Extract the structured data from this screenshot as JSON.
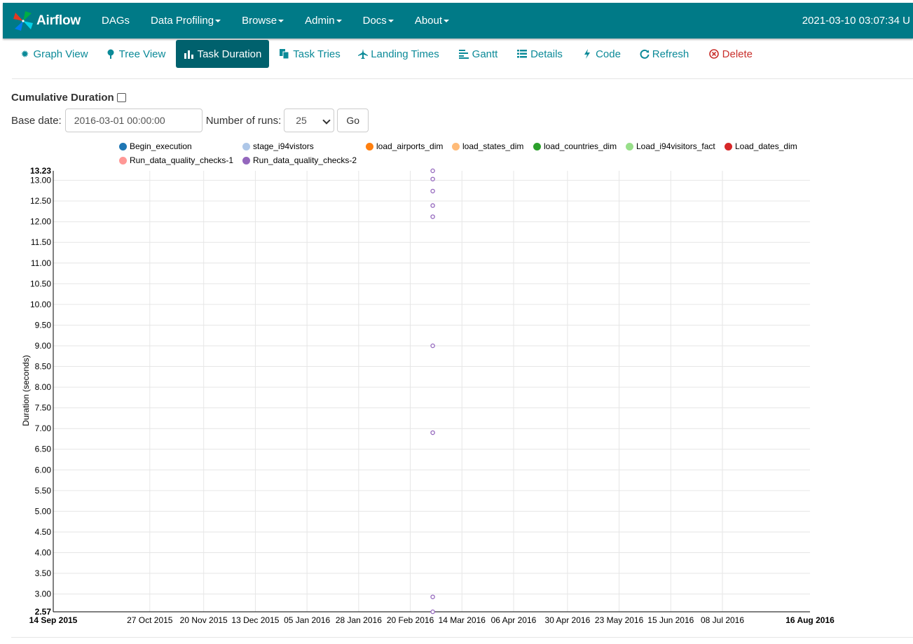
{
  "navbar": {
    "brand": "Airflow",
    "items": [
      {
        "label": "DAGs",
        "dropdown": false
      },
      {
        "label": "Data Profiling",
        "dropdown": true
      },
      {
        "label": "Browse",
        "dropdown": true
      },
      {
        "label": "Admin",
        "dropdown": true
      },
      {
        "label": "Docs",
        "dropdown": true
      },
      {
        "label": "About",
        "dropdown": true
      }
    ],
    "time": "2021-03-10 03:07:34 U",
    "bg_color": "#007a87"
  },
  "tabs": [
    {
      "label": "Graph View",
      "icon": "asterisk-icon",
      "active": false
    },
    {
      "label": "Tree View",
      "icon": "tree-icon",
      "active": false
    },
    {
      "label": "Task Duration",
      "icon": "bar-chart-icon",
      "active": true
    },
    {
      "label": "Task Tries",
      "icon": "duplicate-icon",
      "active": false
    },
    {
      "label": "Landing Times",
      "icon": "plane-icon",
      "active": false
    },
    {
      "label": "Gantt",
      "icon": "align-left-icon",
      "active": false
    },
    {
      "label": "Details",
      "icon": "list-icon",
      "active": false
    },
    {
      "label": "Code",
      "icon": "flash-icon",
      "active": false
    },
    {
      "label": "Refresh",
      "icon": "refresh-icon",
      "active": false
    },
    {
      "label": "Delete",
      "icon": "remove-circle-icon",
      "active": false
    }
  ],
  "form": {
    "cumulative_label": "Cumulative Duration",
    "cumulative_checked": false,
    "base_date_label": "Base date:",
    "base_date_value": "2016-03-01 00:00:00",
    "runs_label": "Number of runs:",
    "runs_value": "25",
    "go_label": "Go"
  },
  "legend": [
    {
      "name": "Begin_execution",
      "color": "#1f77b4"
    },
    {
      "name": "stage_i94vistors",
      "color": "#aec7e8"
    },
    {
      "name": "load_airports_dim",
      "color": "#ff7f0e"
    },
    {
      "name": "load_states_dim",
      "color": "#ffbb78"
    },
    {
      "name": "load_countries_dim",
      "color": "#2ca02c"
    },
    {
      "name": "Load_i94visitors_fact",
      "color": "#98df8a"
    },
    {
      "name": "Load_dates_dim",
      "color": "#d62728"
    },
    {
      "name": "Run_data_quality_checks-1",
      "color": "#ff9896"
    },
    {
      "name": "Run_data_quality_checks-2",
      "color": "#9467bd"
    }
  ],
  "chart_data": {
    "type": "scatter",
    "ylabel": "Duration (seconds)",
    "ylim": [
      2.57,
      13.23
    ],
    "y_ticks": [
      "2.57",
      "3.00",
      "3.50",
      "4.00",
      "4.50",
      "5.00",
      "5.50",
      "6.00",
      "6.50",
      "7.00",
      "7.50",
      "8.00",
      "8.50",
      "9.00",
      "9.50",
      "10.00",
      "10.50",
      "11.00",
      "11.50",
      "12.00",
      "12.50",
      "13.00",
      "13.23"
    ],
    "x_ticks": [
      "14 Sep 2015",
      "27 Oct 2015",
      "20 Nov 2015",
      "13 Dec 2015",
      "05 Jan 2016",
      "28 Jan 2016",
      "20 Feb 2016",
      "14 Mar 2016",
      "06 Apr 2016",
      "30 Apr 2016",
      "23 May 2016",
      "15 Jun 2016",
      "08 Jul 2016",
      "16 Aug 2016"
    ],
    "xlim": [
      "14 Sep 2015",
      "16 Aug 2016"
    ],
    "grid": true,
    "points": [
      {
        "date": "01 Mar 2016",
        "y": 13.23
      },
      {
        "date": "01 Mar 2016",
        "y": 13.03
      },
      {
        "date": "01 Mar 2016",
        "y": 12.74
      },
      {
        "date": "01 Mar 2016",
        "y": 12.39
      },
      {
        "date": "01 Mar 2016",
        "y": 12.12
      },
      {
        "date": "01 Mar 2016",
        "y": 9.0
      },
      {
        "date": "01 Mar 2016",
        "y": 6.9
      },
      {
        "date": "01 Mar 2016",
        "y": 2.93
      },
      {
        "date": "01 Mar 2016",
        "y": 2.57
      }
    ],
    "point_color": "#9467bd"
  }
}
